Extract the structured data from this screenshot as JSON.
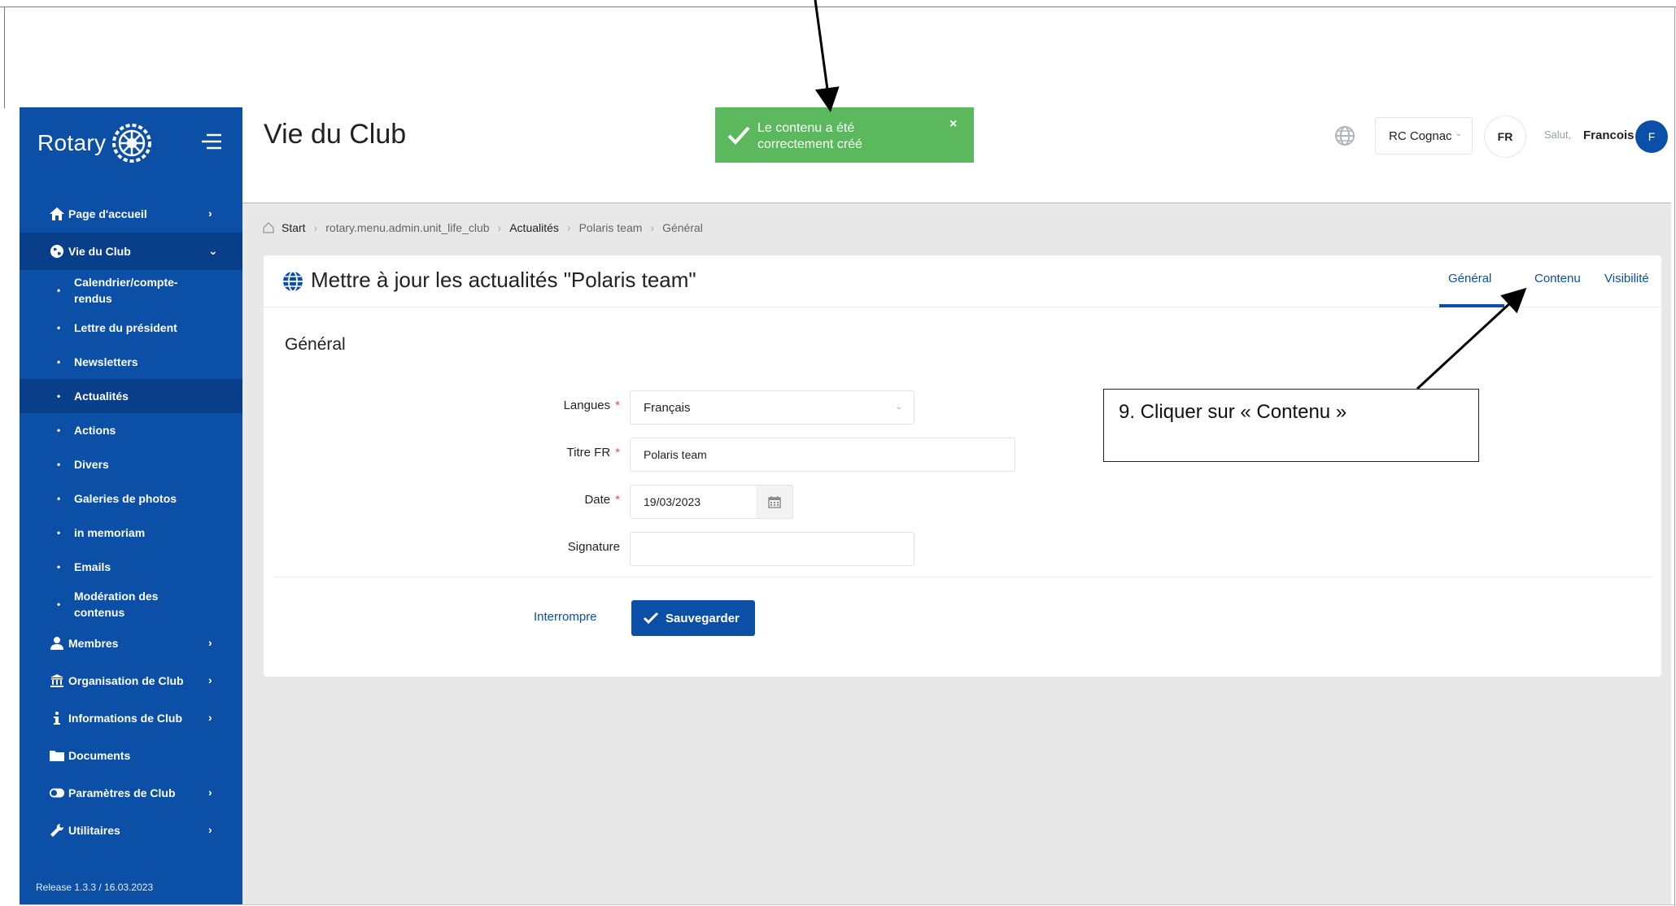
{
  "sidebar": {
    "brand": "Rotary",
    "nav": [
      {
        "label": "Page d'accueil",
        "icon": "home-icon"
      },
      {
        "label": "Vie du Club",
        "icon": "globe-icon"
      }
    ],
    "sub_items": [
      {
        "label": "Calendrier/compte-rendus"
      },
      {
        "label": "Lettre du président"
      },
      {
        "label": "Newsletters"
      },
      {
        "label": "Actualités"
      },
      {
        "label": "Actions"
      },
      {
        "label": "Divers"
      },
      {
        "label": "Galeries de photos"
      },
      {
        "label": "in memoriam"
      },
      {
        "label": "Emails"
      },
      {
        "label": "Modération des contenus"
      }
    ],
    "nav_bottom": [
      {
        "label": "Membres",
        "icon": "user-icon"
      },
      {
        "label": "Organisation de Club",
        "icon": "bank-icon"
      },
      {
        "label": "Informations de Club",
        "icon": "info-icon"
      },
      {
        "label": "Documents",
        "icon": "folder-icon"
      },
      {
        "label": "Paramètres de Club",
        "icon": "toggle-icon"
      },
      {
        "label": "Utilitaires",
        "icon": "wrench-icon"
      }
    ],
    "release": "Release 1.3.3 / 16.03.2023"
  },
  "header": {
    "title": "Vie du Club",
    "toast": "Le contenu a été correctement créé",
    "toast_close": "×",
    "club": "RC Cognac",
    "lang": "FR",
    "salut": "Salut,",
    "user": "Francois",
    "avatar": "F"
  },
  "breadcrumb": [
    "Start",
    "rotary.menu.admin.unit_life_club",
    "Actualités",
    "Polaris team",
    "Général"
  ],
  "card": {
    "title": "Mettre à jour les actualités \"Polaris team\"",
    "tabs": [
      "Général",
      "Contenu",
      "Visibilité"
    ],
    "section": "Général",
    "fields": {
      "langues_label": "Langues",
      "langues_value": "Français",
      "titre_label": "Titre FR",
      "titre_value": "Polaris team",
      "date_label": "Date",
      "date_value": "19/03/2023",
      "signature_label": "Signature",
      "signature_value": ""
    },
    "required_mark": "*",
    "cancel": "Interrompre",
    "save": "Sauvegarder"
  },
  "annotation": {
    "text": "9. Cliquer sur « Contenu »"
  },
  "colors": {
    "primary": "#0b4fa6",
    "sidebar_active": "#093f88",
    "toast": "#5cb85c",
    "required": "#d9534f",
    "content_bg": "#e8e8e8"
  }
}
